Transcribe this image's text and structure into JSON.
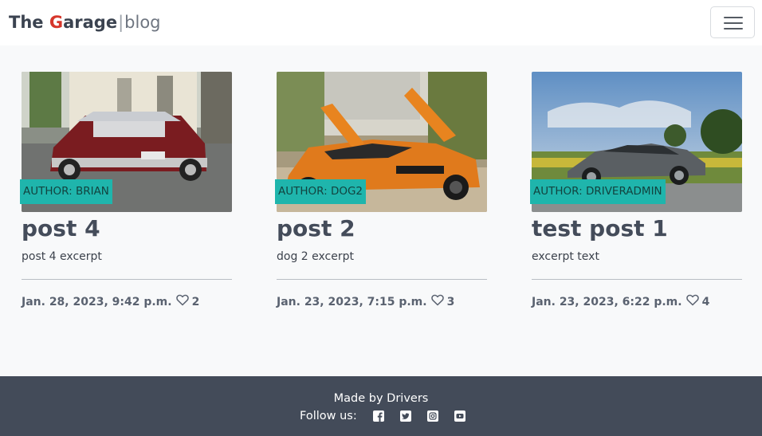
{
  "brand": {
    "the": "The ",
    "g": "G",
    "arage": "arage",
    "sep": "|",
    "blog": "blog"
  },
  "navbar": {
    "toggler_icon": "hamburger-icon"
  },
  "posts": [
    {
      "author": "AUTHOR: BRIAN",
      "title": "post 4",
      "excerpt": "post 4 excerpt",
      "date": "Jan. 28, 2023, 9:42 p.m.",
      "likes": "2"
    },
    {
      "author": "AUTHOR: DOG2",
      "title": "post 2",
      "excerpt": "dog 2 excerpt",
      "date": "Jan. 23, 2023, 7:15 p.m.",
      "likes": "3"
    },
    {
      "author": "AUTHOR: DRIVERADMIN",
      "title": "test post 1",
      "excerpt": "excerpt text",
      "date": "Jan. 23, 2023, 6:22 p.m.",
      "likes": "4"
    }
  ],
  "footer": {
    "made_by": "Made by Drivers",
    "follow_label": "Follow us:",
    "social": [
      "facebook-icon",
      "twitter-icon",
      "instagram-icon",
      "youtube-icon"
    ]
  },
  "colors": {
    "accent": "#1fb5ac",
    "brand_g": "#d6362b",
    "footer_bg": "#434b59"
  }
}
